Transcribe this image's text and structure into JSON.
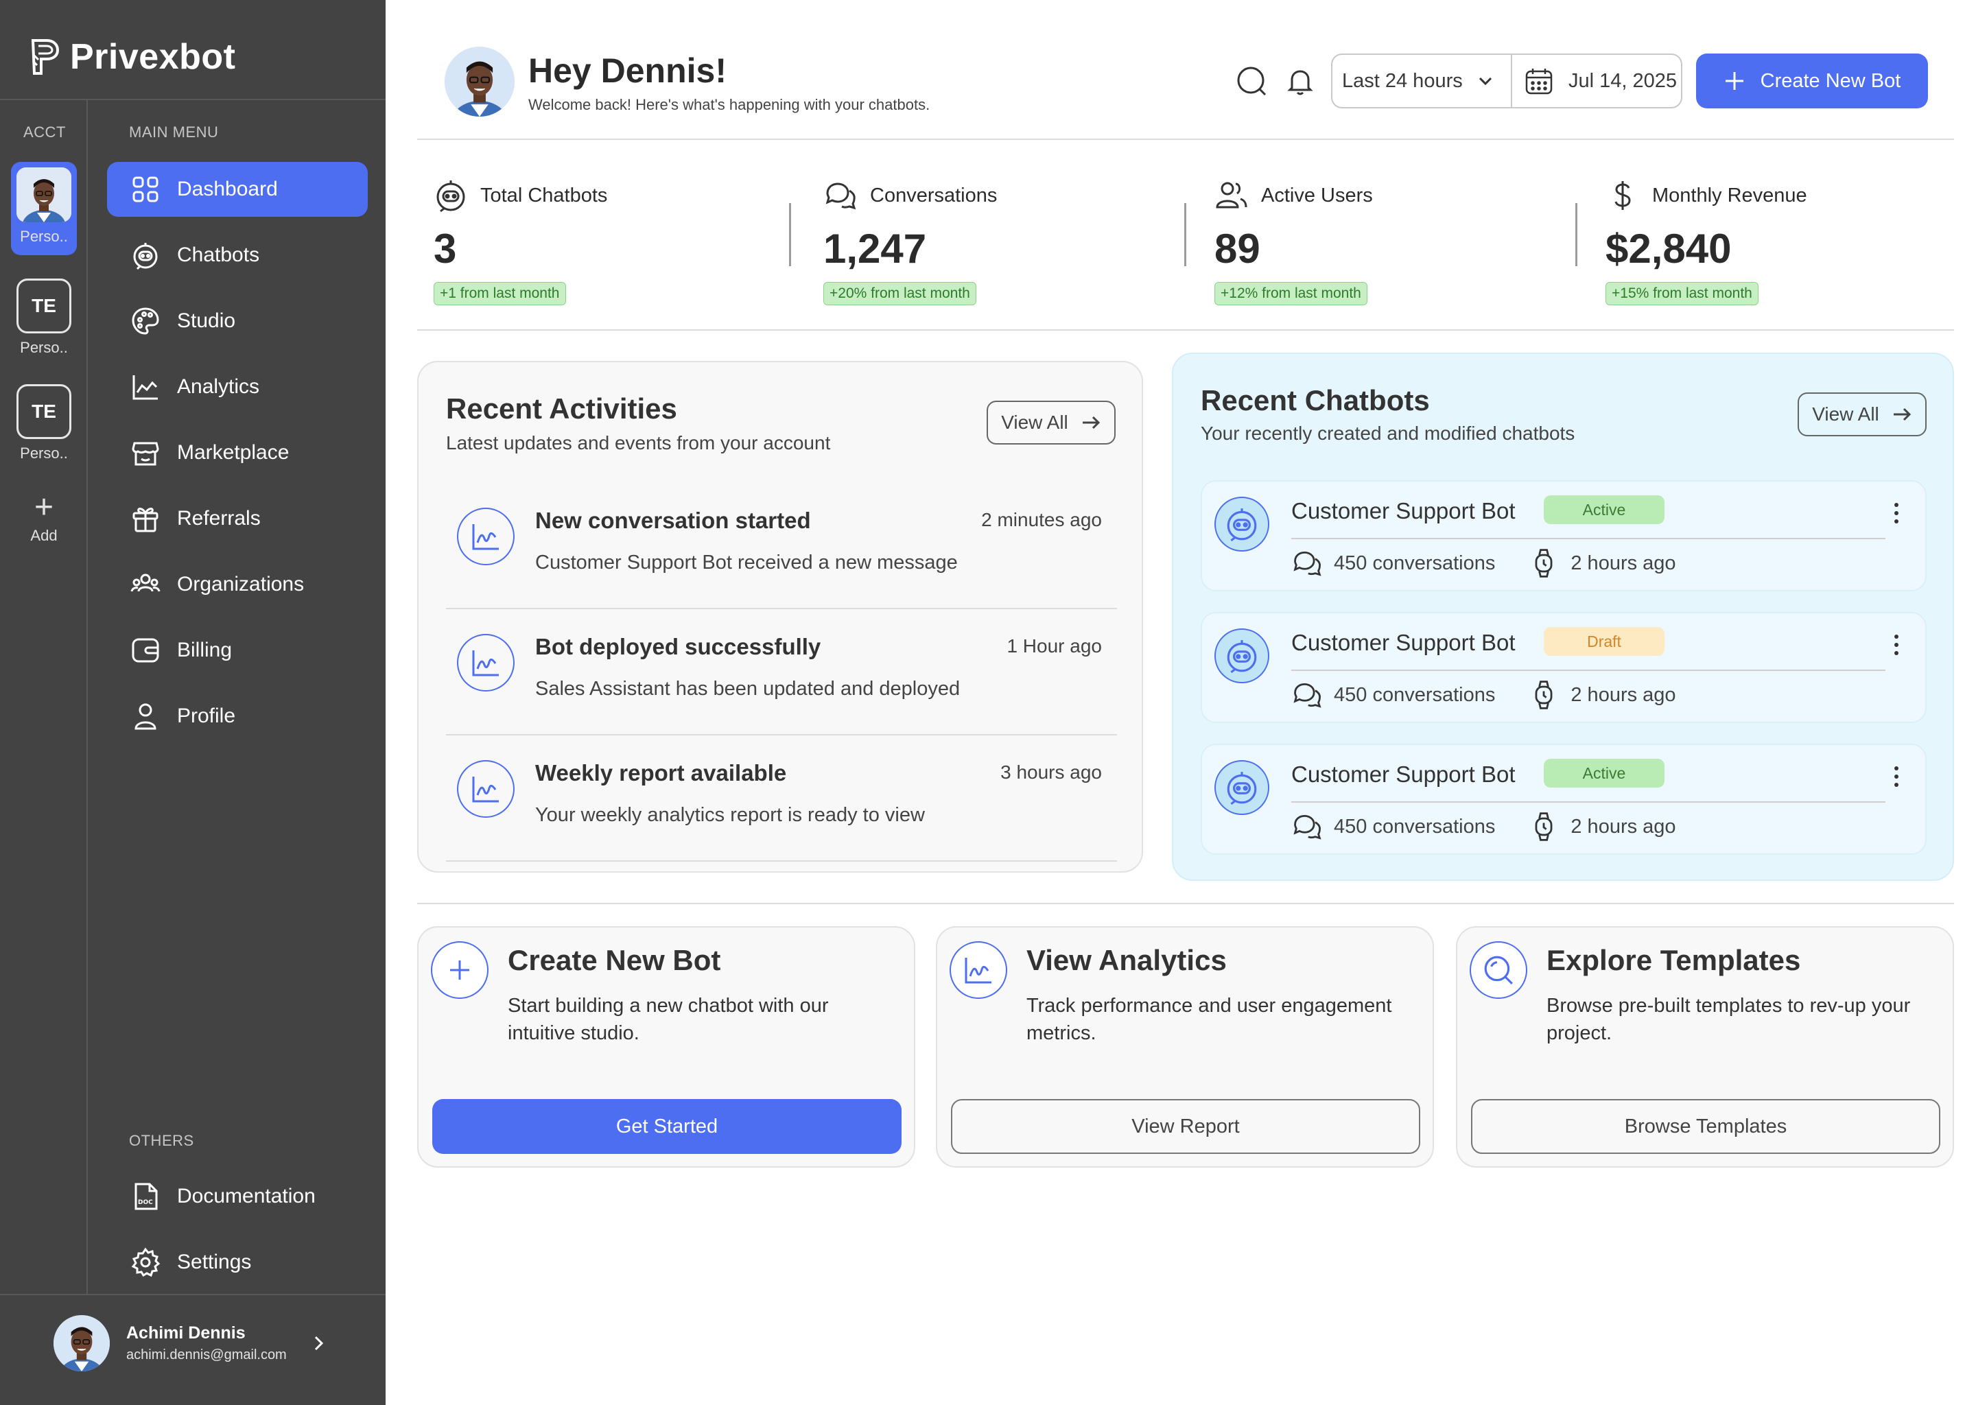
{
  "brand": {
    "name": "Privexbot"
  },
  "accounts": {
    "label": "ACCT",
    "items": [
      {
        "caption": "Perso..",
        "initials": ""
      },
      {
        "caption": "Perso..",
        "initials": "TE"
      },
      {
        "caption": "Perso..",
        "initials": "TE"
      }
    ],
    "add_label": "Add"
  },
  "sidebar": {
    "main_label": "MAIN MENU",
    "items": [
      {
        "label": "Dashboard",
        "icon": "grid-icon",
        "active": true
      },
      {
        "label": "Chatbots",
        "icon": "bot-icon"
      },
      {
        "label": "Studio",
        "icon": "palette-icon"
      },
      {
        "label": "Analytics",
        "icon": "chart-icon"
      },
      {
        "label": "Marketplace",
        "icon": "store-icon"
      },
      {
        "label": "Referrals",
        "icon": "gift-icon"
      },
      {
        "label": "Organizations",
        "icon": "users-icon"
      },
      {
        "label": "Billing",
        "icon": "wallet-icon"
      },
      {
        "label": "Profile",
        "icon": "user-icon"
      }
    ],
    "others_label": "OTHERS",
    "others": [
      {
        "label": "Documentation",
        "icon": "doc-icon"
      },
      {
        "label": "Settings",
        "icon": "gear-icon"
      }
    ]
  },
  "user": {
    "name": "Achimi Dennis",
    "email": "achimi.dennis@gmail.com"
  },
  "header": {
    "greeting": "Hey Dennis!",
    "subtitle": "Welcome back! Here's what's happening with your chatbots.",
    "range": "Last 24 hours",
    "date": "Jul 14, 2025",
    "create_label": "Create New Bot"
  },
  "stats": [
    {
      "label": "Total Chatbots",
      "value": "3",
      "change": "+1 from last month"
    },
    {
      "label": "Conversations",
      "value": "1,247",
      "change": "+20% from last month"
    },
    {
      "label": "Active Users",
      "value": "89",
      "change": "+12% from last month"
    },
    {
      "label": "Monthly Revenue",
      "value": "$2,840",
      "change": "+15% from last month"
    }
  ],
  "activities": {
    "title": "Recent Activities",
    "subtitle": "Latest updates and events from your account",
    "view_all": "View All",
    "items": [
      {
        "title": "New conversation started",
        "time": "2 minutes ago",
        "desc": "Customer Support Bot received a new message"
      },
      {
        "title": "Bot deployed successfully",
        "time": "1 Hour ago",
        "desc": "Sales Assistant has been updated and deployed"
      },
      {
        "title": "Weekly report available",
        "time": "3 hours ago",
        "desc": "Your weekly analytics report is ready to view"
      }
    ]
  },
  "chatbots": {
    "title": "Recent Chatbots",
    "subtitle": "Your recently created and modified chatbots",
    "view_all": "View All",
    "items": [
      {
        "name": "Customer Support Bot",
        "status": "Active",
        "conversations": "450 conversations",
        "updated": "2 hours ago"
      },
      {
        "name": "Customer Support Bot",
        "status": "Draft",
        "conversations": "450 conversations",
        "updated": "2 hours ago"
      },
      {
        "name": "Customer Support Bot",
        "status": "Active",
        "conversations": "450 conversations",
        "updated": "2 hours ago"
      }
    ]
  },
  "actions": [
    {
      "title": "Create New Bot",
      "desc": "Start building a new chatbot with our intuitive studio.",
      "button": "Get Started"
    },
    {
      "title": "View Analytics",
      "desc": "Track performance and user engagement metrics.",
      "button": "View Report"
    },
    {
      "title": "Explore Templates",
      "desc": "Browse pre-built templates to rev-up your project.",
      "button": "Browse Templates"
    }
  ],
  "colors": {
    "sidebar_bg": "#434343",
    "accent": "#4d6ef0",
    "success_bg": "#c7efc4",
    "draft_bg": "#fde9c2",
    "bots_panel_bg": "#e6f6fd"
  }
}
